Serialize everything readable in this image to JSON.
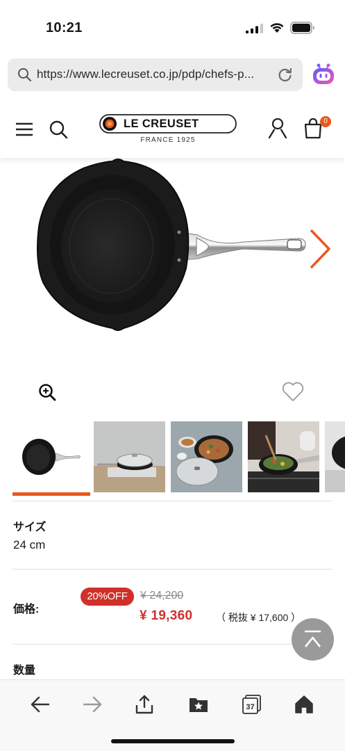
{
  "status_bar": {
    "time": "10:21"
  },
  "browser": {
    "url": "https://www.lecreuset.co.jp/pdp/chefs-p..."
  },
  "header": {
    "brand": "LE CREUSET",
    "brand_sub": "FRANCE 1925",
    "cart_count": "0"
  },
  "product": {
    "size_label": "サイズ",
    "size_value": "24 cm",
    "price_label": "価格:",
    "discount_badge": "20%OFF",
    "original_price": "¥ 24,200",
    "sale_price": "¥ 19,360",
    "tax_excluded": "（ 税抜 ¥ 17,600 ）",
    "quantity_label": "数量"
  },
  "thumbnails": [
    {
      "name": "pan-top-view"
    },
    {
      "name": "pan-with-lid-on-table"
    },
    {
      "name": "pan-with-food-and-dishes"
    },
    {
      "name": "cooking-on-stove"
    },
    {
      "name": "pan-partial"
    }
  ],
  "bottom_toolbar": {
    "tabs_count": "37"
  },
  "colors": {
    "accent": "#e8591c",
    "sale": "#d0302a",
    "badge": "#d0302a"
  }
}
